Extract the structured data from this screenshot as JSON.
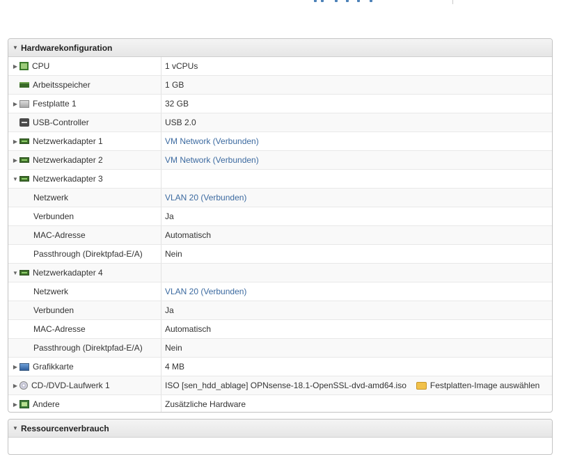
{
  "hardware": {
    "title": "Hardwarekonfiguration",
    "rows": [
      {
        "label": "CPU",
        "value": "1 vCPUs"
      },
      {
        "label": "Arbeitsspeicher",
        "value": "1 GB"
      },
      {
        "label": "Festplatte 1",
        "value": "32 GB"
      },
      {
        "label": "USB-Controller",
        "value": "USB 2.0"
      },
      {
        "label": "Netzwerkadapter 1",
        "value": "VM Network (Verbunden)"
      },
      {
        "label": "Netzwerkadapter 2",
        "value": "VM Network (Verbunden)"
      },
      {
        "label": "Netzwerkadapter 3",
        "value": ""
      },
      {
        "label": "Netzwerk",
        "value": "VLAN 20 (Verbunden)"
      },
      {
        "label": "Verbunden",
        "value": "Ja"
      },
      {
        "label": "MAC-Adresse",
        "value": "Automatisch"
      },
      {
        "label": "Passthrough (Direktpfad-E/A)",
        "value": "Nein"
      },
      {
        "label": "Netzwerkadapter 4",
        "value": ""
      },
      {
        "label": "Netzwerk",
        "value": "VLAN 20 (Verbunden)"
      },
      {
        "label": "Verbunden",
        "value": "Ja"
      },
      {
        "label": "MAC-Adresse",
        "value": "Automatisch"
      },
      {
        "label": "Passthrough (Direktpfad-E/A)",
        "value": "Nein"
      },
      {
        "label": "Grafikkarte",
        "value": "4 MB"
      },
      {
        "label": "CD-/DVD-Laufwerk 1",
        "value": "ISO [sen_hdd_ablage] OPNsense-18.1-OpenSSL-dvd-amd64.iso",
        "action": "Festplatten-Image auswählen"
      },
      {
        "label": "Andere",
        "value": "Zusätzliche Hardware"
      }
    ]
  },
  "resources": {
    "title": "Ressourcenverbrauch"
  },
  "icons": {
    "cpu": "cpu-icon",
    "memory": "memory-icon",
    "disk": "hard-disk-icon",
    "usb": "usb-icon",
    "network": "network-adapter-icon",
    "display": "display-icon",
    "cd": "cd-dvd-icon",
    "other": "other-hardware-icon",
    "folder": "folder-icon"
  },
  "colors": {
    "link": "#3c6aa0",
    "header_bg": "#ececec"
  }
}
